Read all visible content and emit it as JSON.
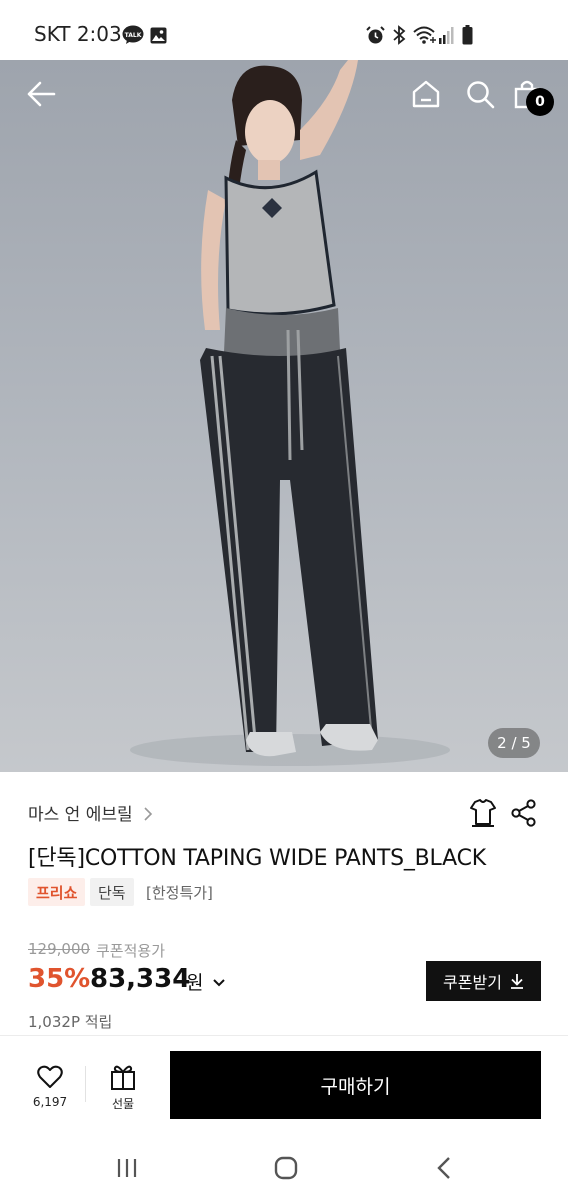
{
  "status_bar": {
    "carrier_time": "SKT 2:03",
    "talk_badge": "TALK"
  },
  "header": {
    "cart_count": "0"
  },
  "image": {
    "counter": "2 / 5"
  },
  "product": {
    "brand": "마스 언 에브릴",
    "title": "[단독]COTTON TAPING WIDE PANTS_BLACK",
    "tags": [
      "프리쇼",
      "단독",
      "[한정특가]"
    ],
    "original_price": "129,000",
    "coupon_applied_label": "쿠폰적용가",
    "discount": "35%",
    "price": "83,334",
    "currency": "원",
    "coupon_button": "쿠폰받기",
    "points": "1,032P 적립"
  },
  "action_bar": {
    "likes": "6,197",
    "gift_label": "선물",
    "buy_label": "구매하기"
  },
  "colors": {
    "accent": "#e0542e",
    "dark": "#000000"
  }
}
